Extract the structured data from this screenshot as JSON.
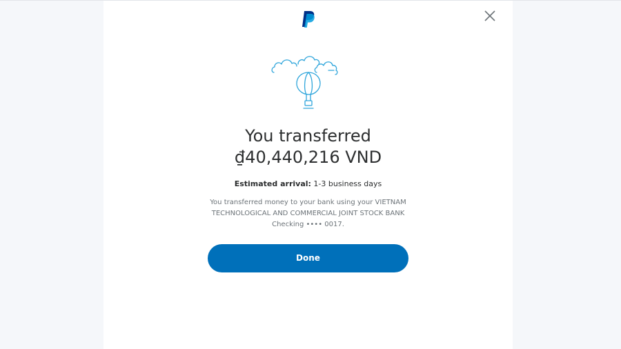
{
  "brand": {
    "logo_icon": "paypal-logo-icon",
    "primary_color": "#003087",
    "secondary_color": "#009cde"
  },
  "header": {
    "close_icon": "close-icon"
  },
  "illustration": {
    "icon": "hot-air-balloon-with-clouds-icon",
    "color": "#2ea5db"
  },
  "confirmation": {
    "title": "You transferred",
    "amount": "₫40,440,216 VND",
    "arrival_label": "Estimated arrival:",
    "arrival_value": "1-3 business days",
    "description": "You transferred money to your bank using your VIETNAM TECHNOLOGICAL AND COMMERCIAL JOINT STOCK BANK Checking •••• 0017."
  },
  "actions": {
    "done_label": "Done",
    "done_color": "#0070ba"
  }
}
